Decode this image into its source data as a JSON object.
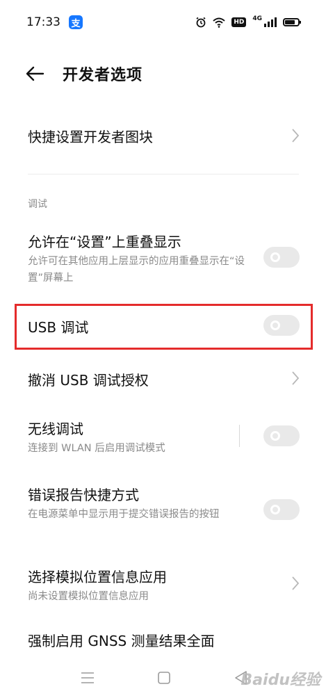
{
  "status_bar": {
    "time": "17:33",
    "alipay_glyph": "支",
    "hd_badge": "HD",
    "network_label": "4G",
    "icons": [
      "alarm-icon",
      "wifi-icon",
      "hd-icon",
      "signal-icon",
      "battery-icon"
    ]
  },
  "header": {
    "back_icon": "arrow-left-icon",
    "title": "开发者选项"
  },
  "items": {
    "quick_tiles": {
      "title": "快捷设置开发者图块"
    },
    "section_debug": {
      "label": "调试"
    },
    "overlay": {
      "title": "允许在“设置”上重叠显示",
      "subtitle": "允许可在其他应用上层显示的应用重叠显示在“设置”屏幕上",
      "enabled": false
    },
    "usb_debug": {
      "title": "USB 调试",
      "enabled": false
    },
    "revoke_usb": {
      "title": "撤消 USB 调试授权"
    },
    "wireless_debug": {
      "title": "无线调试",
      "subtitle": "连接到 WLAN 后启用调试模式",
      "enabled": false
    },
    "bug_report": {
      "title": "错误报告快捷方式",
      "subtitle": "在电源菜单中显示用于提交错误报告的按钮",
      "enabled": false
    },
    "mock_location": {
      "title": "选择模拟位置信息应用",
      "subtitle": "尚未设置模拟位置信息应用"
    },
    "gnss": {
      "title": "强制启用 GNSS 测量结果全面"
    }
  },
  "nav_bar": {
    "icons": [
      "menu-icon",
      "home-icon",
      "back-icon"
    ]
  },
  "watermark": {
    "text": "Baidu经验"
  },
  "colors": {
    "highlight": "#e42b2b",
    "toggle_off": "#e9e9e9",
    "subtitle": "#8a8a8a"
  }
}
